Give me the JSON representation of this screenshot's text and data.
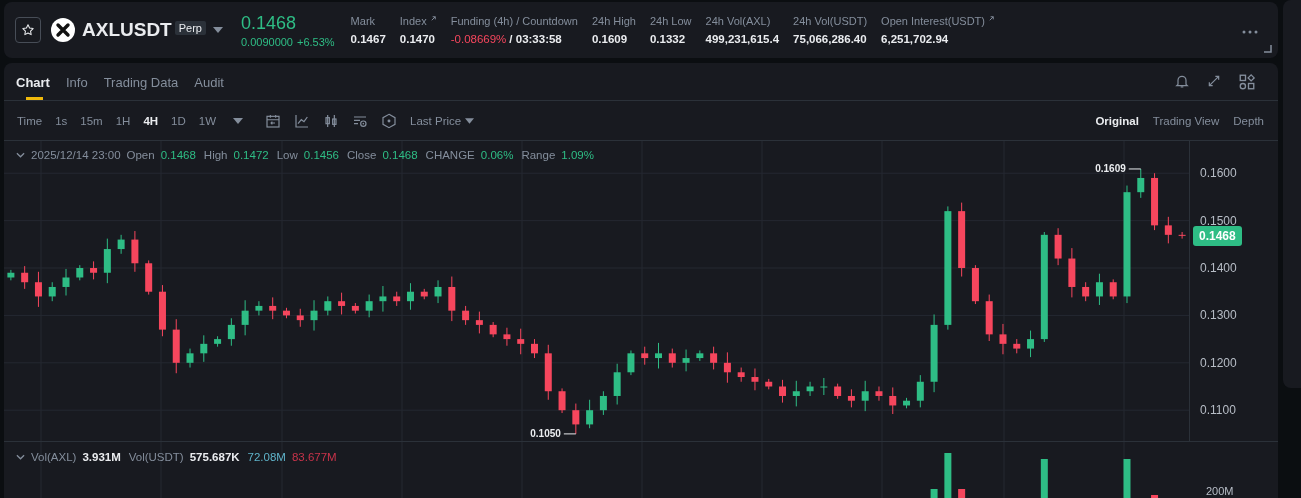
{
  "header": {
    "favorite": false,
    "symbol": "AXLUSDT",
    "badge": "Perp",
    "price": "0.1468",
    "change": "0.0090000",
    "change_pct": "+6.53%",
    "stats": [
      {
        "label": "Mark",
        "value": "0.1467",
        "external": false,
        "negative": false
      },
      {
        "label": "Index",
        "value": "0.1470",
        "external": true,
        "negative": false
      },
      {
        "label": "Funding (4h) / Countdown",
        "value": "-0.08669%",
        "value_2": "/ 03:33:58",
        "external": false,
        "negative": true
      },
      {
        "label": "24h High",
        "value": "0.1609",
        "external": false,
        "negative": false
      },
      {
        "label": "24h Low",
        "value": "0.1332",
        "external": false,
        "negative": false
      },
      {
        "label": "24h Vol(AXL)",
        "value": "499,231,615.4",
        "external": false,
        "negative": false
      },
      {
        "label": "24h Vol(USDT)",
        "value": "75,066,286.40",
        "external": false,
        "negative": false
      },
      {
        "label": "Open Interest(USDT)",
        "value": "6,251,702.94",
        "external": true,
        "negative": false
      }
    ]
  },
  "tabs": [
    {
      "label": "Chart",
      "selected": true
    },
    {
      "label": "Info",
      "selected": false
    },
    {
      "label": "Trading Data",
      "selected": false
    },
    {
      "label": "Audit",
      "selected": false
    }
  ],
  "toolbar": {
    "time_label": "Time",
    "intervals": [
      {
        "label": "1s",
        "selected": false
      },
      {
        "label": "15m",
        "selected": false
      },
      {
        "label": "1H",
        "selected": false
      },
      {
        "label": "4H",
        "selected": true
      },
      {
        "label": "1D",
        "selected": false
      },
      {
        "label": "1W",
        "selected": false
      }
    ],
    "price_type": "Last Price",
    "views": [
      {
        "label": "Original",
        "selected": true
      },
      {
        "label": "Trading View",
        "selected": false
      },
      {
        "label": "Depth",
        "selected": false
      }
    ]
  },
  "legend": {
    "date": "2025/12/14 23:00",
    "fields": [
      {
        "label": "Open",
        "value": "0.1468"
      },
      {
        "label": "High",
        "value": "0.1472"
      },
      {
        "label": "Low",
        "value": "0.1456"
      },
      {
        "label": "Close",
        "value": "0.1468"
      },
      {
        "label": "CHANGE",
        "value": "0.06%"
      },
      {
        "label": "Range",
        "value": "1.09%"
      }
    ]
  },
  "chart_data": {
    "type": "candlestick",
    "grid": true,
    "ylim": [
      0.1035,
      0.1668
    ],
    "yticks": [
      {
        "value": 0.11,
        "label": "0.1100"
      },
      {
        "value": 0.12,
        "label": "0.1200"
      },
      {
        "value": 0.13,
        "label": "0.1300"
      },
      {
        "value": 0.14,
        "label": "0.1400"
      },
      {
        "value": 0.15,
        "label": "0.1500"
      },
      {
        "value": 0.16,
        "label": "0.1600"
      }
    ],
    "categories": [
      null,
      null,
      null,
      null,
      null,
      null,
      null,
      null,
      null,
      null,
      null,
      null,
      null,
      null,
      null,
      null,
      null,
      null,
      null,
      null,
      null,
      null,
      null,
      null,
      null,
      null,
      null,
      null,
      null,
      null,
      null,
      null,
      null,
      null,
      null,
      null,
      null,
      null,
      null,
      null,
      null,
      null,
      null,
      null,
      null,
      null,
      null,
      null,
      null,
      null,
      null,
      null,
      null,
      null,
      null,
      null,
      null,
      null,
      null,
      null,
      null,
      null,
      null,
      null,
      null,
      null,
      null,
      null,
      null,
      null,
      null,
      null,
      null,
      null,
      null,
      null,
      null,
      null,
      null,
      null,
      null,
      null,
      null,
      null,
      null,
      null
    ],
    "ohlc": [
      [
        0.138,
        0.1396,
        0.1374,
        0.139
      ],
      [
        0.139,
        0.1404,
        0.1356,
        0.137
      ],
      [
        0.137,
        0.1392,
        0.1318,
        0.134
      ],
      [
        0.134,
        0.137,
        0.133,
        0.136
      ],
      [
        0.136,
        0.1398,
        0.1342,
        0.138
      ],
      [
        0.138,
        0.1406,
        0.1374,
        0.14
      ],
      [
        0.14,
        0.1414,
        0.1376,
        0.139
      ],
      [
        0.139,
        0.1462,
        0.1368,
        0.144
      ],
      [
        0.144,
        0.147,
        0.143,
        0.146
      ],
      [
        0.146,
        0.1478,
        0.1392,
        0.141
      ],
      [
        0.141,
        0.1416,
        0.1344,
        0.135
      ],
      [
        0.135,
        0.1364,
        0.1256,
        0.127
      ],
      [
        0.127,
        0.1292,
        0.1178,
        0.12
      ],
      [
        0.12,
        0.123,
        0.119,
        0.122
      ],
      [
        0.122,
        0.1258,
        0.1202,
        0.124
      ],
      [
        0.124,
        0.1256,
        0.1234,
        0.125
      ],
      [
        0.125,
        0.1294,
        0.1236,
        0.128
      ],
      [
        0.128,
        0.1332,
        0.1258,
        0.131
      ],
      [
        0.131,
        0.133,
        0.13,
        0.132
      ],
      [
        0.132,
        0.1338,
        0.1292,
        0.131
      ],
      [
        0.131,
        0.1316,
        0.1294,
        0.13
      ],
      [
        0.13,
        0.1314,
        0.1276,
        0.129
      ],
      [
        0.129,
        0.1332,
        0.1268,
        0.131
      ],
      [
        0.131,
        0.134,
        0.13,
        0.133
      ],
      [
        0.133,
        0.1348,
        0.1302,
        0.132
      ],
      [
        0.132,
        0.1326,
        0.1304,
        0.131
      ],
      [
        0.131,
        0.1344,
        0.1296,
        0.133
      ],
      [
        0.133,
        0.1362,
        0.1308,
        0.134
      ],
      [
        0.134,
        0.135,
        0.132,
        0.133
      ],
      [
        0.133,
        0.1368,
        0.1312,
        0.135
      ],
      [
        0.135,
        0.1356,
        0.1334,
        0.134
      ],
      [
        0.134,
        0.1374,
        0.1326,
        0.136
      ],
      [
        0.136,
        0.1382,
        0.1288,
        0.131
      ],
      [
        0.131,
        0.132,
        0.128,
        0.129
      ],
      [
        0.129,
        0.1308,
        0.1262,
        0.128
      ],
      [
        0.128,
        0.1286,
        0.1254,
        0.126
      ],
      [
        0.126,
        0.1274,
        0.1236,
        0.125
      ],
      [
        0.125,
        0.1272,
        0.1218,
        0.124
      ],
      [
        0.124,
        0.125,
        0.121,
        0.122
      ],
      [
        0.122,
        0.1238,
        0.1122,
        0.114
      ],
      [
        0.114,
        0.1146,
        0.1094,
        0.11
      ],
      [
        0.11,
        0.1114,
        0.105,
        0.107
      ],
      [
        0.107,
        0.1122,
        0.1062,
        0.11
      ],
      [
        0.11,
        0.114,
        0.109,
        0.113
      ],
      [
        0.113,
        0.1198,
        0.1112,
        0.118
      ],
      [
        0.118,
        0.1226,
        0.1174,
        0.122
      ],
      [
        0.122,
        0.1234,
        0.1196,
        0.121
      ],
      [
        0.121,
        0.1242,
        0.1188,
        0.122
      ],
      [
        0.122,
        0.123,
        0.119,
        0.12
      ],
      [
        0.12,
        0.1228,
        0.1182,
        0.121
      ],
      [
        0.121,
        0.1226,
        0.1204,
        0.122
      ],
      [
        0.122,
        0.1234,
        0.1186,
        0.12
      ],
      [
        0.12,
        0.1222,
        0.1158,
        0.118
      ],
      [
        0.118,
        0.119,
        0.116,
        0.117
      ],
      [
        0.117,
        0.1188,
        0.1142,
        0.116
      ],
      [
        0.116,
        0.1166,
        0.1144,
        0.115
      ],
      [
        0.115,
        0.1164,
        0.1116,
        0.113
      ],
      [
        0.113,
        0.1162,
        0.1108,
        0.114
      ],
      [
        0.114,
        0.116,
        0.113,
        0.115
      ],
      [
        0.115,
        0.1168,
        0.1132,
        0.115
      ],
      [
        0.115,
        0.1156,
        0.1124,
        0.113
      ],
      [
        0.113,
        0.1144,
        0.1106,
        0.112
      ],
      [
        0.112,
        0.1162,
        0.1098,
        0.114
      ],
      [
        0.114,
        0.115,
        0.112,
        0.113
      ],
      [
        0.113,
        0.1148,
        0.1092,
        0.111
      ],
      [
        0.111,
        0.1126,
        0.1104,
        0.112
      ],
      [
        0.112,
        0.1174,
        0.1106,
        0.116
      ],
      [
        0.116,
        0.1302,
        0.1138,
        0.128
      ],
      [
        0.128,
        0.153,
        0.127,
        0.152
      ],
      [
        0.152,
        0.1538,
        0.1382,
        0.14
      ],
      [
        0.14,
        0.1406,
        0.1324,
        0.133
      ],
      [
        0.133,
        0.1344,
        0.1246,
        0.126
      ],
      [
        0.126,
        0.1282,
        0.1218,
        0.124
      ],
      [
        0.124,
        0.125,
        0.122,
        0.123
      ],
      [
        0.123,
        0.1268,
        0.1212,
        0.125
      ],
      [
        0.125,
        0.1476,
        0.1244,
        0.147
      ],
      [
        0.147,
        0.1484,
        0.1406,
        0.142
      ],
      [
        0.142,
        0.1442,
        0.1338,
        0.136
      ],
      [
        0.136,
        0.137,
        0.133,
        0.134
      ],
      [
        0.134,
        0.1388,
        0.1322,
        0.137
      ],
      [
        0.137,
        0.1376,
        0.1334,
        0.134
      ],
      [
        0.134,
        0.1574,
        0.1326,
        0.156
      ],
      [
        0.156,
        0.1609,
        0.1548,
        0.159
      ],
      [
        0.159,
        0.16,
        0.148,
        0.149
      ],
      [
        0.149,
        0.1508,
        0.1452,
        0.147
      ],
      [
        0.147,
        0.1476,
        0.1462,
        0.1468
      ]
    ],
    "annotations": [
      {
        "text": "0.1609"
      },
      {
        "text": "0.1050"
      }
    ]
  },
  "price_axis": {
    "last_price": "0.1468"
  },
  "volume": {
    "fields": [
      {
        "label": "Vol(AXL)",
        "value": "3.931M"
      },
      {
        "label": "Vol(USDT)",
        "value": "575.687K"
      }
    ],
    "averages": [
      {
        "value": "72.08M",
        "color": "#5fb3c9"
      },
      {
        "value": "83.677M",
        "color": "#c8334a"
      }
    ],
    "axis_label": "200M"
  }
}
